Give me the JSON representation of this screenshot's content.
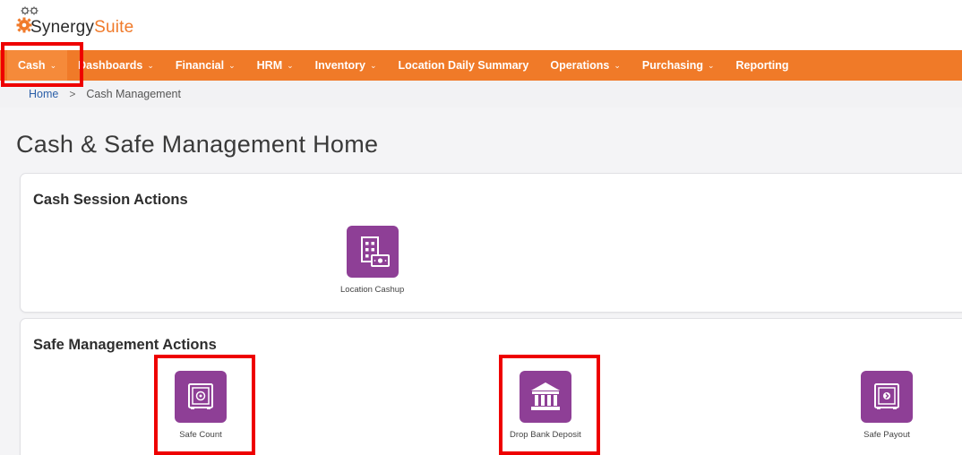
{
  "brand": {
    "name_part1": "Synergy",
    "name_part2": "Suite",
    "accent_color": "#f07a28",
    "tile_color": "#8e3f96",
    "highlight_color": "#ee0000"
  },
  "nav": {
    "items": [
      {
        "label": "Cash",
        "has_dropdown": true,
        "active": true
      },
      {
        "label": "Dashboards",
        "has_dropdown": true
      },
      {
        "label": "Financial",
        "has_dropdown": true
      },
      {
        "label": "HRM",
        "has_dropdown": true
      },
      {
        "label": "Inventory",
        "has_dropdown": true
      },
      {
        "label": "Location Daily Summary",
        "has_dropdown": false
      },
      {
        "label": "Operations",
        "has_dropdown": true
      },
      {
        "label": "Purchasing",
        "has_dropdown": true
      },
      {
        "label": "Reporting",
        "has_dropdown": false
      }
    ],
    "dropdown_glyph": "⌄"
  },
  "breadcrumb": {
    "home": "Home",
    "separator": ">",
    "current": "Cash Management"
  },
  "page": {
    "title": "Cash & Safe Management Home"
  },
  "cash_session": {
    "title": "Cash Session Actions",
    "tiles": [
      {
        "label": "Location Cashup",
        "icon": "building-cash-icon"
      }
    ]
  },
  "safe_management": {
    "title": "Safe Management Actions",
    "tiles": [
      {
        "label": "Safe Count",
        "icon": "safe-icon"
      },
      {
        "label": "Drop Bank Deposit",
        "icon": "bank-icon"
      },
      {
        "label": "Safe Payout",
        "icon": "safe-payout-icon"
      }
    ]
  }
}
